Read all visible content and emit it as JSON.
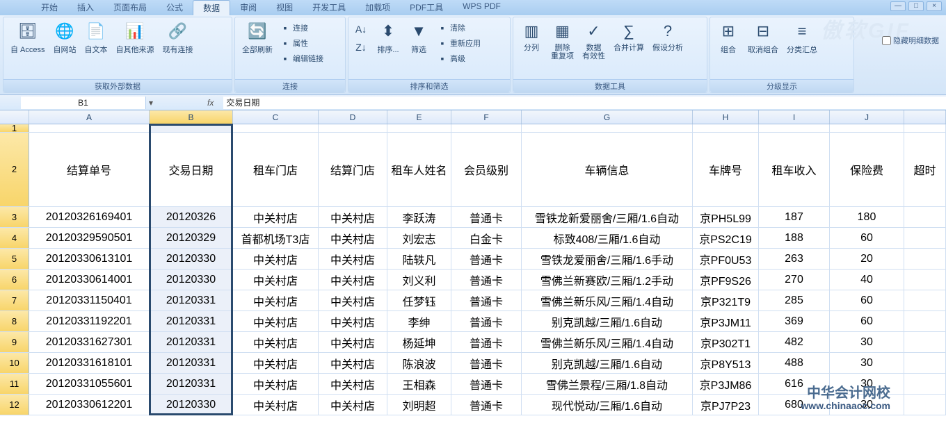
{
  "menu": {
    "tabs": [
      "开始",
      "插入",
      "页面布局",
      "公式",
      "数据",
      "审阅",
      "视图",
      "开发工具",
      "加载项",
      "PDF工具",
      "WPS PDF"
    ],
    "active": 4
  },
  "win": {
    "min": "—",
    "max": "□",
    "close": "×"
  },
  "ribbon": {
    "g1": {
      "label": "获取外部数据",
      "btns": [
        "自 Access",
        "自网站",
        "自文本",
        "自其他来源",
        "现有连接"
      ]
    },
    "g2": {
      "label": "连接",
      "main": "全部刷新",
      "small": [
        "连接",
        "属性",
        "编辑链接"
      ]
    },
    "g3": {
      "label": "排序和筛选",
      "sort": "排序...",
      "filter": "筛选",
      "small": [
        "清除",
        "重新应用",
        "高级"
      ]
    },
    "g4": {
      "label": "数据工具",
      "btns": [
        "分列",
        "删除\n重复项",
        "数据\n有效性",
        "合并计算",
        "假设分析"
      ]
    },
    "g5": {
      "label": "分级显示",
      "btns": [
        "组合",
        "取消组合",
        "分类汇总"
      ]
    }
  },
  "hide_detail": "隐藏明细数据",
  "namebox": {
    "ref": "B1",
    "formula": "交易日期"
  },
  "cols": [
    "A",
    "B",
    "C",
    "D",
    "E",
    "F",
    "G",
    "H",
    "I",
    "J"
  ],
  "headers": [
    "结算单号",
    "交易日期",
    "租车门店",
    "结算门店",
    "租车人姓名",
    "会员级别",
    "车辆信息",
    "车牌号",
    "租车收入",
    "保险费",
    "超时"
  ],
  "rows": [
    [
      "20120326169401",
      "20120326",
      "中关村店",
      "中关村店",
      "李跃涛",
      "普通卡",
      "雪铁龙新爱丽舍/三厢/1.6自动",
      "京PH5L99",
      "187",
      "180"
    ],
    [
      "20120329590501",
      "20120329",
      "首都机场T3店",
      "中关村店",
      "刘宏志",
      "白金卡",
      "标致408/三厢/1.6自动",
      "京PS2C19",
      "188",
      "60"
    ],
    [
      "20120330613101",
      "20120330",
      "中关村店",
      "中关村店",
      "陆轶凡",
      "普通卡",
      "雪铁龙爱丽舍/三厢/1.6手动",
      "京PF0U53",
      "263",
      "20"
    ],
    [
      "20120330614001",
      "20120330",
      "中关村店",
      "中关村店",
      "刘义利",
      "普通卡",
      "雪佛兰新赛欧/三厢/1.2手动",
      "京PF9S26",
      "270",
      "40"
    ],
    [
      "20120331150401",
      "20120331",
      "中关村店",
      "中关村店",
      "任梦钰",
      "普通卡",
      "雪佛兰新乐风/三厢/1.4自动",
      "京P321T9",
      "285",
      "60"
    ],
    [
      "20120331192201",
      "20120331",
      "中关村店",
      "中关村店",
      "李绅",
      "普通卡",
      "别克凯越/三厢/1.6自动",
      "京P3JM11",
      "369",
      "60"
    ],
    [
      "20120331627301",
      "20120331",
      "中关村店",
      "中关村店",
      "杨延坤",
      "普通卡",
      "雪佛兰新乐风/三厢/1.4自动",
      "京P302T1",
      "482",
      "30"
    ],
    [
      "20120331618101",
      "20120331",
      "中关村店",
      "中关村店",
      "陈浪波",
      "普通卡",
      "别克凯越/三厢/1.6自动",
      "京P8Y513",
      "488",
      "30"
    ],
    [
      "20120331055601",
      "20120331",
      "中关村店",
      "中关村店",
      "王相森",
      "普通卡",
      "雪佛兰景程/三厢/1.8自动",
      "京P3JM86",
      "616",
      "30"
    ],
    [
      "20120330612201",
      "20120330",
      "中关村店",
      "中关村店",
      "刘明超",
      "普通卡",
      "现代悦动/三厢/1.6自动",
      "京PJ7P23",
      "680",
      "30"
    ]
  ],
  "wm1": "傲软GIF",
  "wm2": {
    "a": "中华会计网校",
    "b": "www.chinaacc.com"
  }
}
